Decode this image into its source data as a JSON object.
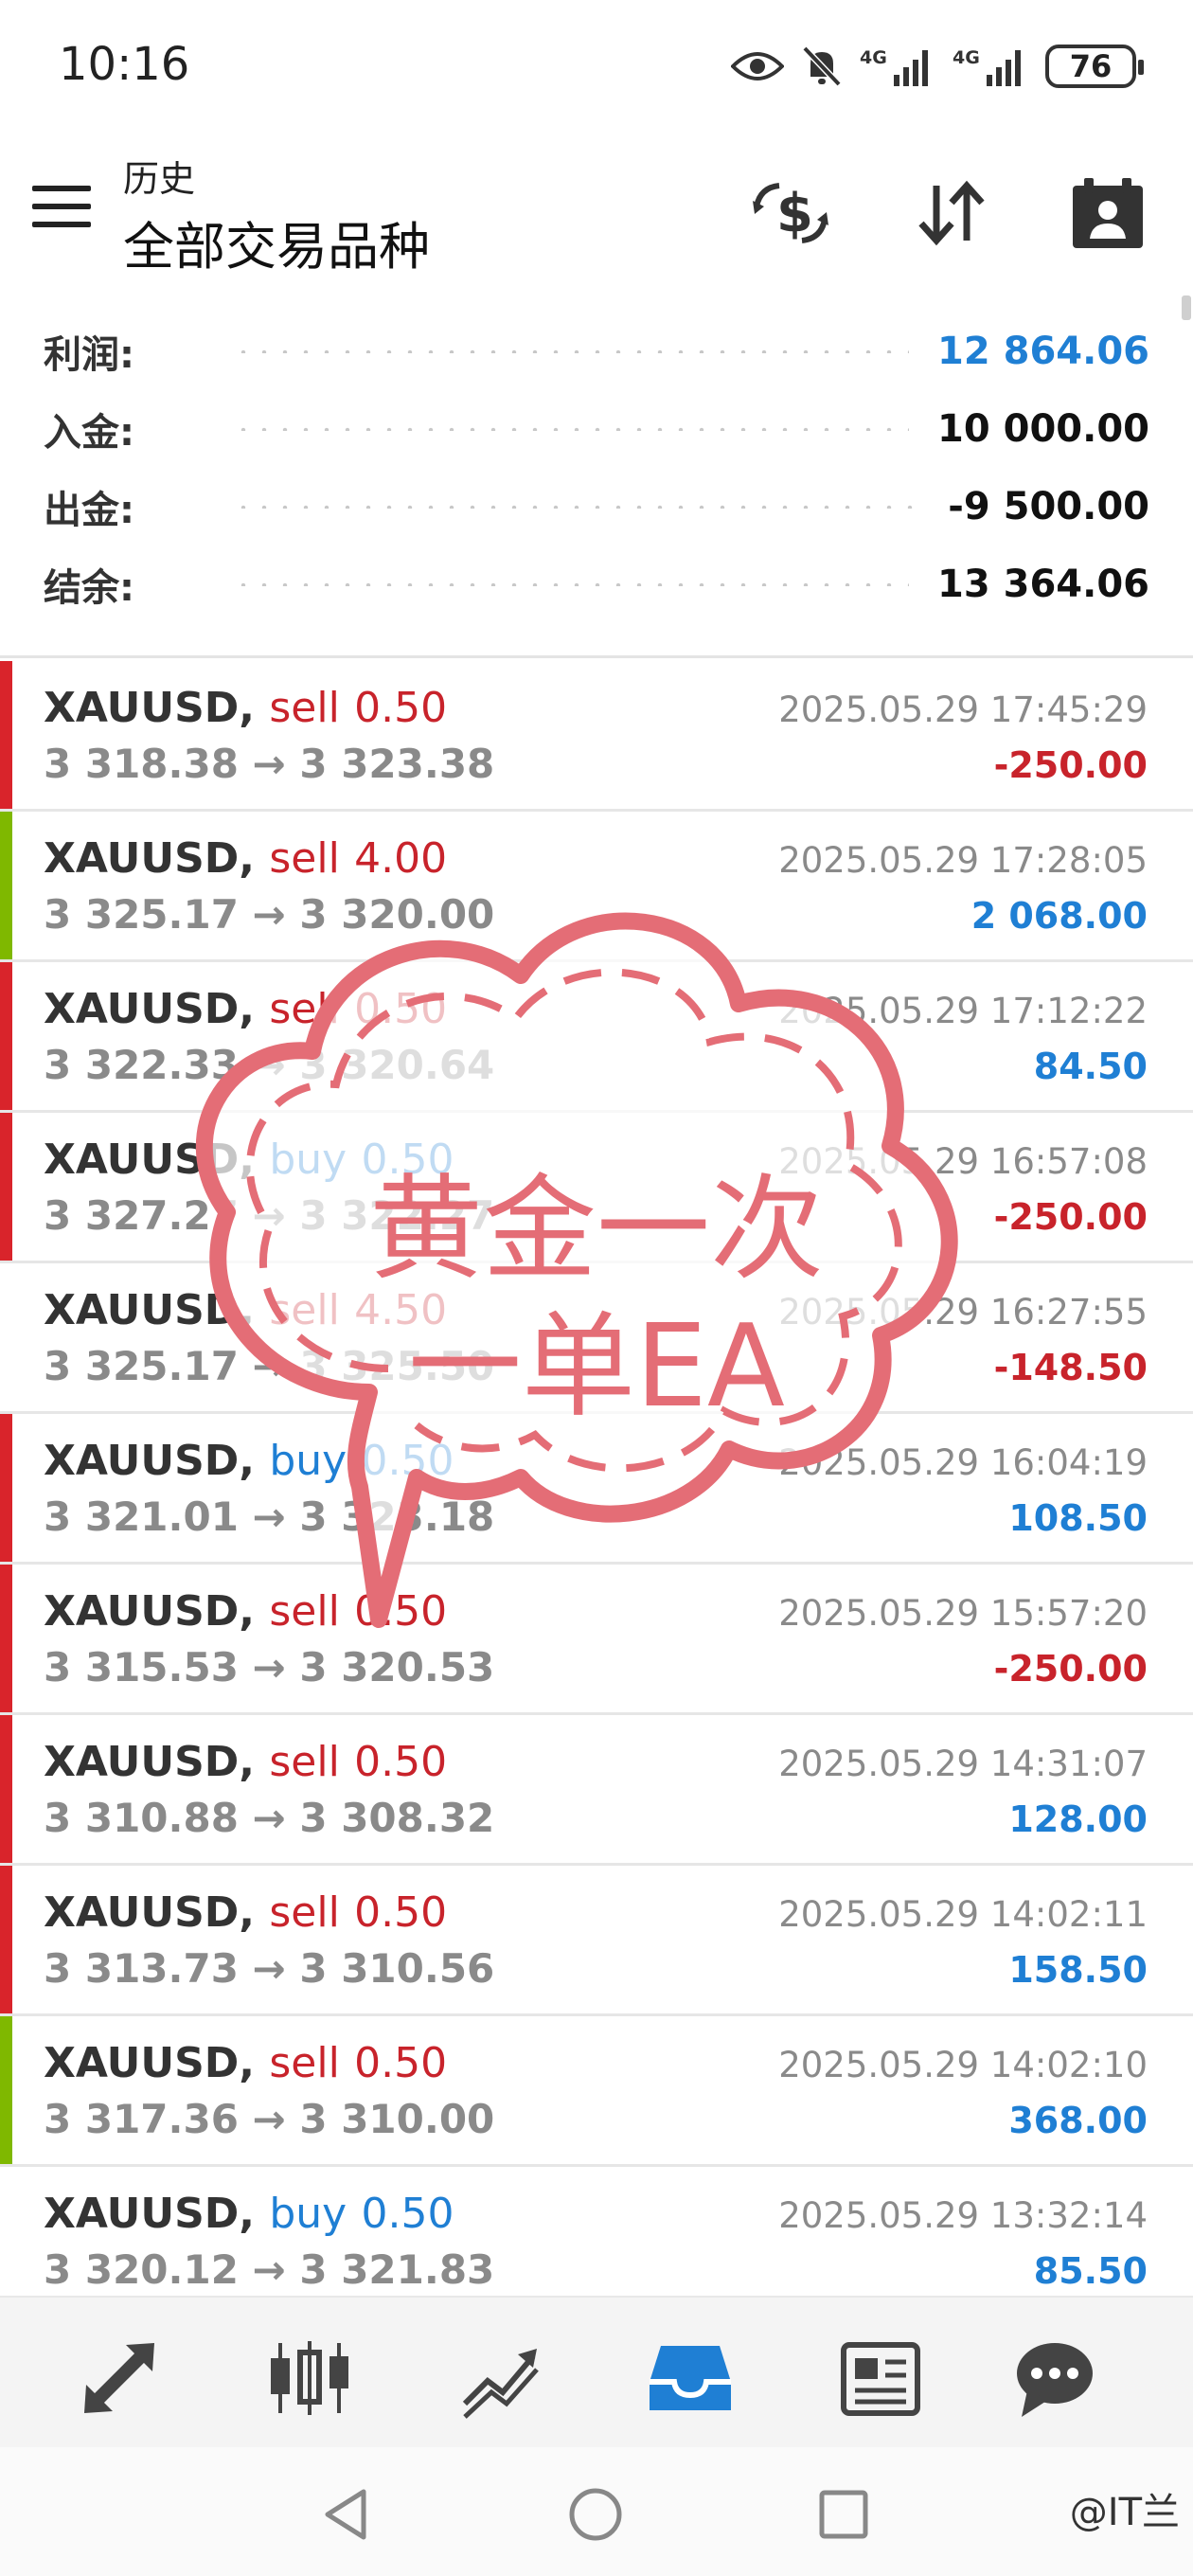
{
  "status_bar": {
    "time": "10:16",
    "icons": [
      "eye-icon",
      "bell-off-icon",
      "signal-4g-icon",
      "signal-4g-icon"
    ],
    "network_label_1": "4G",
    "network_label_2": "4G",
    "battery": "76"
  },
  "header": {
    "subtitle": "历史",
    "title": "全部交易品种",
    "actions": [
      "dollar-sync-icon",
      "sort-icon",
      "calendar-person-icon"
    ]
  },
  "summary": {
    "profit_label": "利润:",
    "profit_value": "12 864.06",
    "deposit_label": "入金:",
    "deposit_value": "10 000.00",
    "withdrawal_label": "出金:",
    "withdrawal_value": "-9 500.00",
    "balance_label": "结余:",
    "balance_value": "13 364.06"
  },
  "colors": {
    "loss_bar": "#d9242b",
    "win_bar": "#7fb800",
    "sell": "#c8232b",
    "buy": "#1f7fd4",
    "profit_positive": "#1f7fd4",
    "profit_negative": "#c8232b",
    "overlay": "#e46d76",
    "active_nav": "#1f7fd4"
  },
  "trades": [
    {
      "symbol": "XAUUSD,",
      "side": "sell",
      "volume": "0.50",
      "prices": "3 318.38 → 3 323.38",
      "time": "2025.05.29 17:45:29",
      "profit": "-250.00",
      "bar": "red"
    },
    {
      "symbol": "XAUUSD,",
      "side": "sell",
      "volume": "4.00",
      "prices": "3 325.17 → 3 320.00",
      "time": "2025.05.29 17:28:05",
      "profit": "2 068.00",
      "bar": "green"
    },
    {
      "symbol": "XAUUSD,",
      "side": "sell",
      "volume": "0.50",
      "prices": "3 322.33 → 3 320.64",
      "time": "2025.05.29 17:12:22",
      "profit": "84.50",
      "bar": "red"
    },
    {
      "symbol": "XAUUSD,",
      "side": "buy",
      "volume": "0.50",
      "prices": "3 327.27 → 3 322.27",
      "time": "2025.05.29 16:57:08",
      "profit": "-250.00",
      "bar": "red"
    },
    {
      "symbol": "XAUUSD,",
      "side": "sell",
      "volume": "4.50",
      "prices": "3 325.17 → 3 325.50",
      "time": "2025.05.29 16:27:55",
      "profit": "-148.50",
      "bar": "none"
    },
    {
      "symbol": "XAUUSD,",
      "side": "buy",
      "volume": "0.50",
      "prices": "3 321.01 → 3 323.18",
      "time": "2025.05.29 16:04:19",
      "profit": "108.50",
      "bar": "red"
    },
    {
      "symbol": "XAUUSD,",
      "side": "sell",
      "volume": "0.50",
      "prices": "3 315.53 → 3 320.53",
      "time": "2025.05.29 15:57:20",
      "profit": "-250.00",
      "bar": "red"
    },
    {
      "symbol": "XAUUSD,",
      "side": "sell",
      "volume": "0.50",
      "prices": "3 310.88 → 3 308.32",
      "time": "2025.05.29 14:31:07",
      "profit": "128.00",
      "bar": "red"
    },
    {
      "symbol": "XAUUSD,",
      "side": "sell",
      "volume": "0.50",
      "prices": "3 313.73 → 3 310.56",
      "time": "2025.05.29 14:02:11",
      "profit": "158.50",
      "bar": "red"
    },
    {
      "symbol": "XAUUSD,",
      "side": "sell",
      "volume": "0.50",
      "prices": "3 317.36 → 3 310.00",
      "time": "2025.05.29 14:02:10",
      "profit": "368.00",
      "bar": "green"
    },
    {
      "symbol": "XAUUSD,",
      "side": "buy",
      "volume": "0.50",
      "prices": "3 320.12 → 3 321.83",
      "time": "2025.05.29 13:32:14",
      "profit": "85.50",
      "bar": "none"
    }
  ],
  "overlay": {
    "line1": "黄金一次",
    "line2": "一单EA"
  },
  "bottom_nav": {
    "items": [
      "quotes-icon",
      "chart-icon",
      "trade-icon",
      "history-icon",
      "news-icon",
      "chat-icon"
    ],
    "active": "history-icon"
  },
  "system_nav": [
    "back-icon",
    "home-icon",
    "recents-icon"
  ],
  "watermark": "@IT兰"
}
